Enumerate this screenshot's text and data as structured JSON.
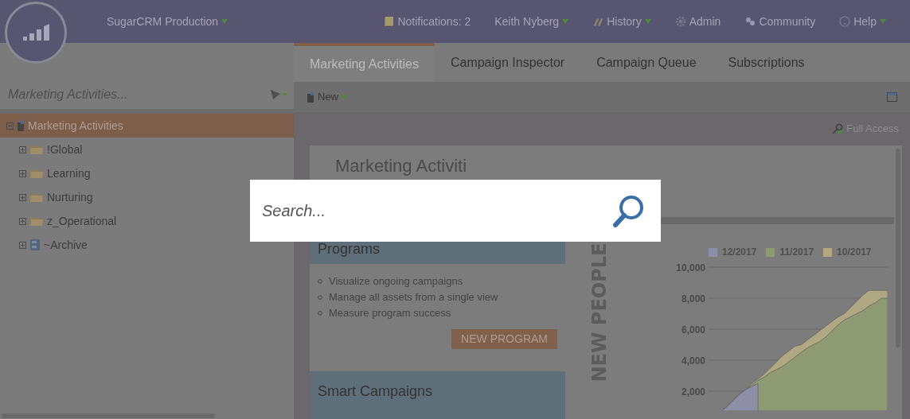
{
  "header": {
    "org": "SugarCRM Production",
    "links": [
      {
        "kind": "notifications",
        "label": "Notifications: 2",
        "dropdown": false
      },
      {
        "kind": "user",
        "label": "Keith Nyberg",
        "dropdown": true
      },
      {
        "kind": "history",
        "label": "History",
        "dropdown": true
      },
      {
        "kind": "admin",
        "label": "Admin",
        "dropdown": false
      },
      {
        "kind": "community",
        "label": "Community",
        "dropdown": false
      },
      {
        "kind": "help",
        "label": "Help",
        "dropdown": true
      }
    ]
  },
  "sidebar": {
    "search_placeholder": "Marketing Activities...",
    "tree": [
      {
        "label": "Marketing Activities",
        "kind": "root",
        "selected": true,
        "expanded": true,
        "children": [
          {
            "label": "!Global",
            "kind": "folder",
            "selected": false,
            "expanded": false
          },
          {
            "label": "Learning",
            "kind": "folder",
            "selected": false,
            "expanded": false
          },
          {
            "label": "Nurturing",
            "kind": "folder",
            "selected": false,
            "expanded": false
          },
          {
            "label": "z_Operational",
            "kind": "folder",
            "selected": false,
            "expanded": false
          },
          {
            "label": "~Archive",
            "kind": "archive",
            "selected": false,
            "expanded": false
          }
        ]
      }
    ]
  },
  "tabs": [
    {
      "label": "Marketing Activities",
      "selected": true
    },
    {
      "label": "Campaign Inspector",
      "selected": false
    },
    {
      "label": "Campaign Queue",
      "selected": false
    },
    {
      "label": "Subscriptions",
      "selected": false
    }
  ],
  "toolbar": {
    "new_label": "New",
    "access": "Full Access"
  },
  "content": {
    "heading": "Marketing Activiti",
    "programs": {
      "title": "Programs",
      "bullets": [
        "Visualize ongoing campaigns",
        "Manage all assets from a single view",
        "Measure program success"
      ],
      "button": "NEW PROGRAM"
    },
    "smart_campaigns": {
      "title": "Smart Campaigns"
    },
    "chart_data": {
      "type": "area",
      "ylabel": "NEW PEOPLE",
      "grid": true,
      "legend": "top",
      "ylim": [
        0,
        10000
      ],
      "yticks": [
        {
          "value": 2000,
          "label": "2,000"
        },
        {
          "value": 4000,
          "label": "4,000"
        },
        {
          "value": 6000,
          "label": "6,000"
        },
        {
          "value": 8000,
          "label": "8,000"
        },
        {
          "value": 10000,
          "label": "10,000"
        }
      ],
      "series": [
        {
          "name": "12/2017",
          "color": "#8e8ea8",
          "values": [
            0,
            300,
            700,
            1000,
            1400,
            1800,
            2100,
            2300,
            2500,
            null,
            null,
            null,
            null,
            null,
            null,
            null,
            null,
            null,
            null,
            null,
            null,
            null,
            null,
            null,
            null,
            null,
            null,
            null,
            null,
            null
          ]
        },
        {
          "name": "11/2017",
          "color": "#8d9a72",
          "values": [
            0,
            300,
            700,
            1000,
            1400,
            1800,
            2100,
            2400,
            2700,
            2900,
            3200,
            3400,
            3600,
            3900,
            4200,
            4500,
            4800,
            5000,
            5200,
            5500,
            5900,
            6300,
            6600,
            6800,
            7000,
            7200,
            7500,
            7700,
            8000,
            8000
          ]
        },
        {
          "name": "10/2017",
          "color": "#b0a882",
          "values": [
            0,
            300,
            700,
            1000,
            1400,
            1800,
            2100,
            2500,
            2800,
            3100,
            3500,
            3900,
            4300,
            4600,
            4900,
            5000,
            5300,
            5600,
            5900,
            6200,
            6500,
            6800,
            7000,
            7400,
            7800,
            8200,
            8500,
            8500,
            8500,
            8500
          ]
        }
      ]
    }
  },
  "search": {
    "placeholder": "Search..."
  }
}
